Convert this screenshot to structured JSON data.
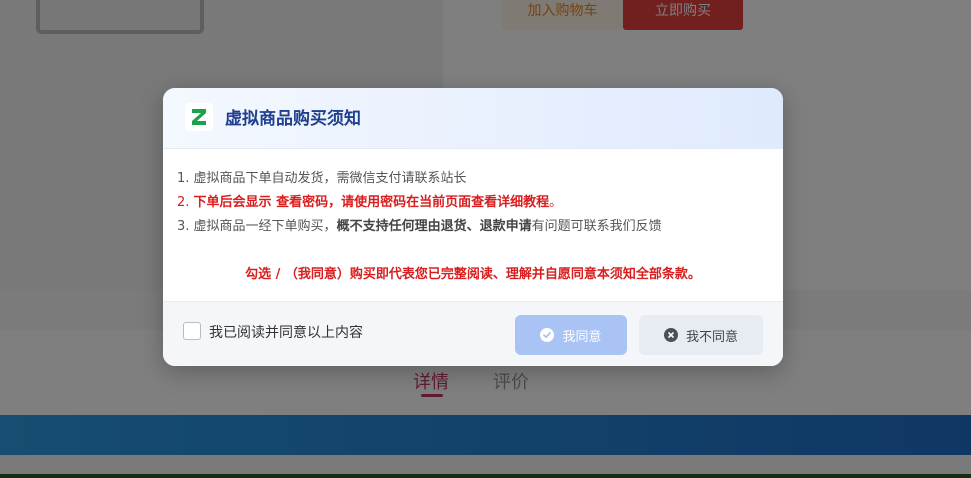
{
  "background": {
    "add_to_cart": "加入购物车",
    "buy_now": "立即购买",
    "tabs": [
      "详情",
      "评价"
    ]
  },
  "modal": {
    "title": "虚拟商品购买须知",
    "rules": {
      "r1": {
        "num": "1.",
        "text": "虚拟商品下单自动发货，需微信支付请联系站长"
      },
      "r2": {
        "num": "2.",
        "text_a": "下单后会显示 查看密码，",
        "text_b": "请使用密码在当前页面查看详细教程",
        "text_c": "。"
      },
      "r3": {
        "num": "3.",
        "text_a": "虚拟商品一经下单购买，",
        "text_b": "概不支持任何理由退货、退款申请",
        "text_c": "有问题可联系我们反馈"
      }
    },
    "notice": "勾选 / （我同意）购买即代表您已完整阅读、理解并自愿同意本须知全部条款。",
    "checkbox_label": "我已阅读并同意以上内容",
    "agree_label": "我同意",
    "disagree_label": "我不同意"
  },
  "colors": {
    "title": "#1f3f8f",
    "warning_red": "#d81e1e",
    "agree_button": "#a9c3f5",
    "disagree_button": "#e7ebf2",
    "logo_green": "#1aa34a"
  },
  "icons": {
    "logo": "brand-logo-icon",
    "agree": "check-circle-icon",
    "disagree": "close-circle-icon"
  }
}
